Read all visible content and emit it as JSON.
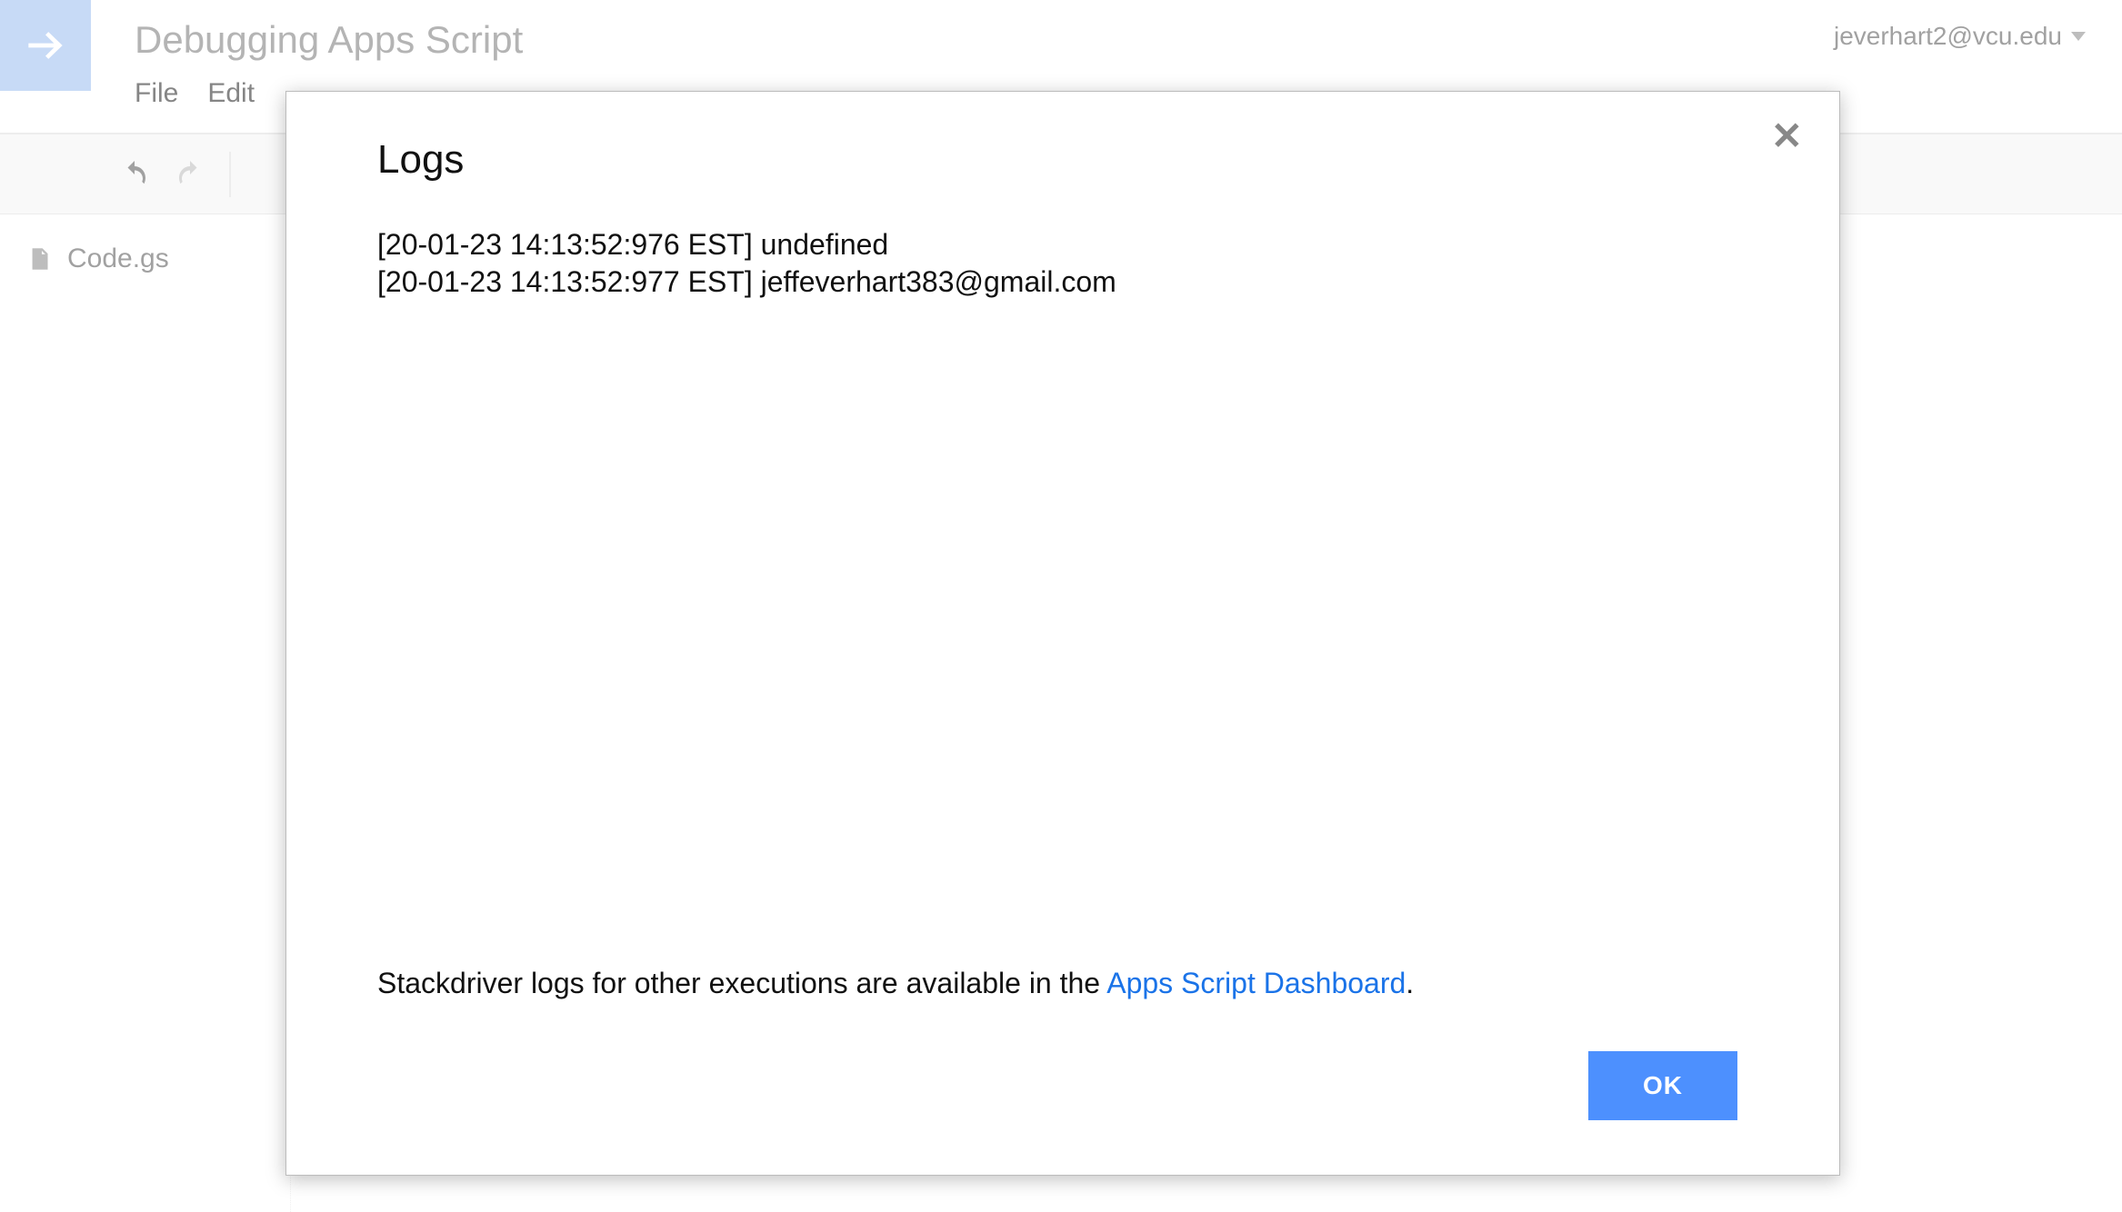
{
  "header": {
    "project_title": "Debugging Apps Script",
    "user_email": "jeverhart2@vcu.edu",
    "menu": {
      "file": "File",
      "edit": "Edit"
    }
  },
  "sidebar": {
    "file_name": "Code.gs"
  },
  "modal": {
    "title": "Logs",
    "logs": [
      "[20-01-23 14:13:52:976 EST] undefined",
      "[20-01-23 14:13:52:977 EST] jeffeverhart383@gmail.com"
    ],
    "footer_prefix": "Stackdriver logs for other executions are available in the ",
    "footer_link": "Apps Script Dashboard",
    "footer_suffix": ".",
    "ok_label": "OK"
  },
  "colors": {
    "primary_button": "#4d90fe",
    "link": "#1a73e8",
    "logo_bg": "#9bbdf0"
  }
}
